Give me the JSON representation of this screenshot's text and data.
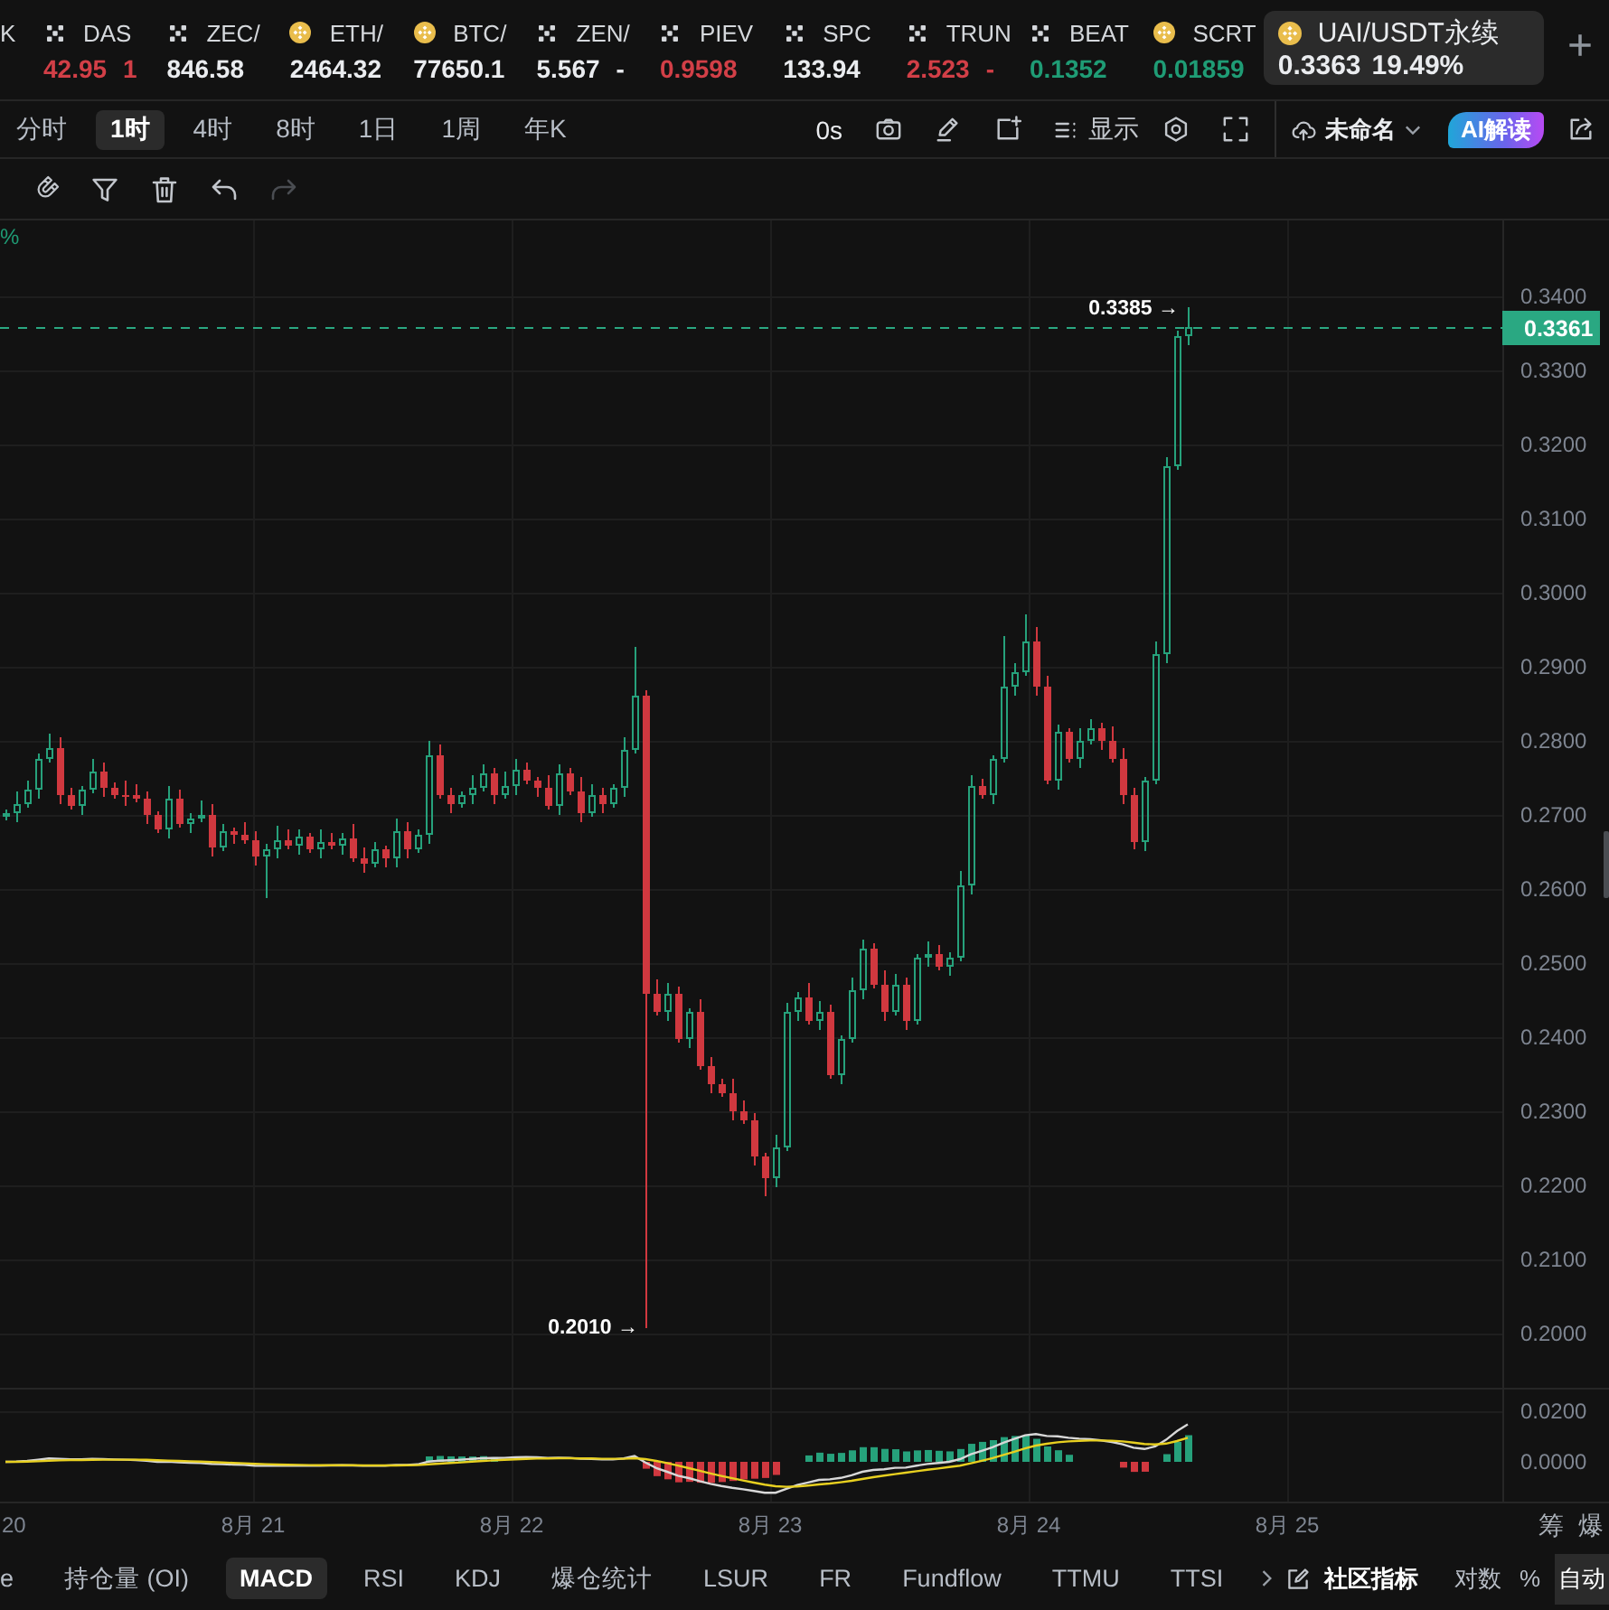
{
  "tickers": [
    {
      "kind": "plain",
      "name": "K"
    },
    {
      "kind": "cross",
      "name": "DAS",
      "price": "42.95",
      "change": "1",
      "color": "#d23f47"
    },
    {
      "kind": "cross",
      "name": "ZEC/",
      "price": "846.58",
      "color": "#eaecef"
    },
    {
      "kind": "coin",
      "name": "ETH/",
      "price": "2464.32",
      "color": "#eaecef"
    },
    {
      "kind": "coin",
      "name": "BTC/",
      "price": "77650.1",
      "color": "#eaecef"
    },
    {
      "kind": "cross",
      "name": "ZEN/",
      "price": "5.567",
      "change": "-",
      "color": "#eaecef"
    },
    {
      "kind": "cross",
      "name": "PIEV",
      "price": "0.9598",
      "color": "#d23f47"
    },
    {
      "kind": "cross",
      "name": "SPC",
      "price": "133.94",
      "color": "#eaecef"
    },
    {
      "kind": "cross",
      "name": "TRUN",
      "price": "2.523",
      "change": "-",
      "color": "#d23f47"
    },
    {
      "kind": "cross",
      "name": "BEAT",
      "price": "0.1352",
      "color": "#1f9c75"
    },
    {
      "kind": "coin",
      "name": "SCRT",
      "price": "0.01859",
      "color": "#1f9c75"
    }
  ],
  "active_ticker": {
    "kind": "coin",
    "name": "UAI/USDT永续",
    "price": "0.3363",
    "change": "19.49%"
  },
  "add_tab": "+",
  "timeframes": [
    {
      "label": "分时",
      "selected": false
    },
    {
      "label": "1时",
      "selected": true
    },
    {
      "label": "4时",
      "selected": false
    },
    {
      "label": "8时",
      "selected": false
    },
    {
      "label": "1日",
      "selected": false
    },
    {
      "label": "1周",
      "selected": false
    },
    {
      "label": "年K",
      "selected": false
    }
  ],
  "toolbar": {
    "countdown": "0s",
    "display": "显示",
    "layout_name": "未命名",
    "ai": "AI解读"
  },
  "history": [
    {
      "kind": "undo",
      "disabled": false
    },
    {
      "kind": "redo",
      "disabled": true
    }
  ],
  "chart": {
    "corner_label": "%",
    "price_ticks": [
      "0.3400",
      "0.3300",
      "0.3200",
      "0.3100",
      "0.3000",
      "0.2900",
      "0.2800",
      "0.2700",
      "0.2600",
      "0.2500",
      "0.2400",
      "0.2300",
      "0.2200",
      "0.2100",
      "0.2000"
    ],
    "last_price": "0.3361",
    "high_marker": "0.3385 →",
    "low_marker": "0.2010 →",
    "macd_ticks": [
      "0.0200",
      "0.0000"
    ],
    "dates": [
      "20",
      "8月 21",
      "8月 22",
      "8月 23",
      "8月 24",
      "8月 25"
    ],
    "side_labels": [
      "筹",
      "爆"
    ]
  },
  "indicator_tabs": [
    {
      "label": "e",
      "selected": false
    },
    {
      "label": "持仓量 (OI)",
      "selected": false
    },
    {
      "label": "MACD",
      "selected": true
    },
    {
      "label": "RSI",
      "selected": false
    },
    {
      "label": "KDJ",
      "selected": false
    },
    {
      "label": "爆仓统计",
      "selected": false
    },
    {
      "label": "LSUR",
      "selected": false
    },
    {
      "label": "FR",
      "selected": false
    },
    {
      "label": "Fundflow",
      "selected": false
    },
    {
      "label": "TTMU",
      "selected": false
    },
    {
      "label": "TTSI",
      "selected": false
    }
  ],
  "community_indicators": "社区指标",
  "scale_options": [
    {
      "label": "对数",
      "selected": false
    },
    {
      "label": "%",
      "selected": false
    },
    {
      "label": "自动",
      "selected": true
    }
  ]
}
